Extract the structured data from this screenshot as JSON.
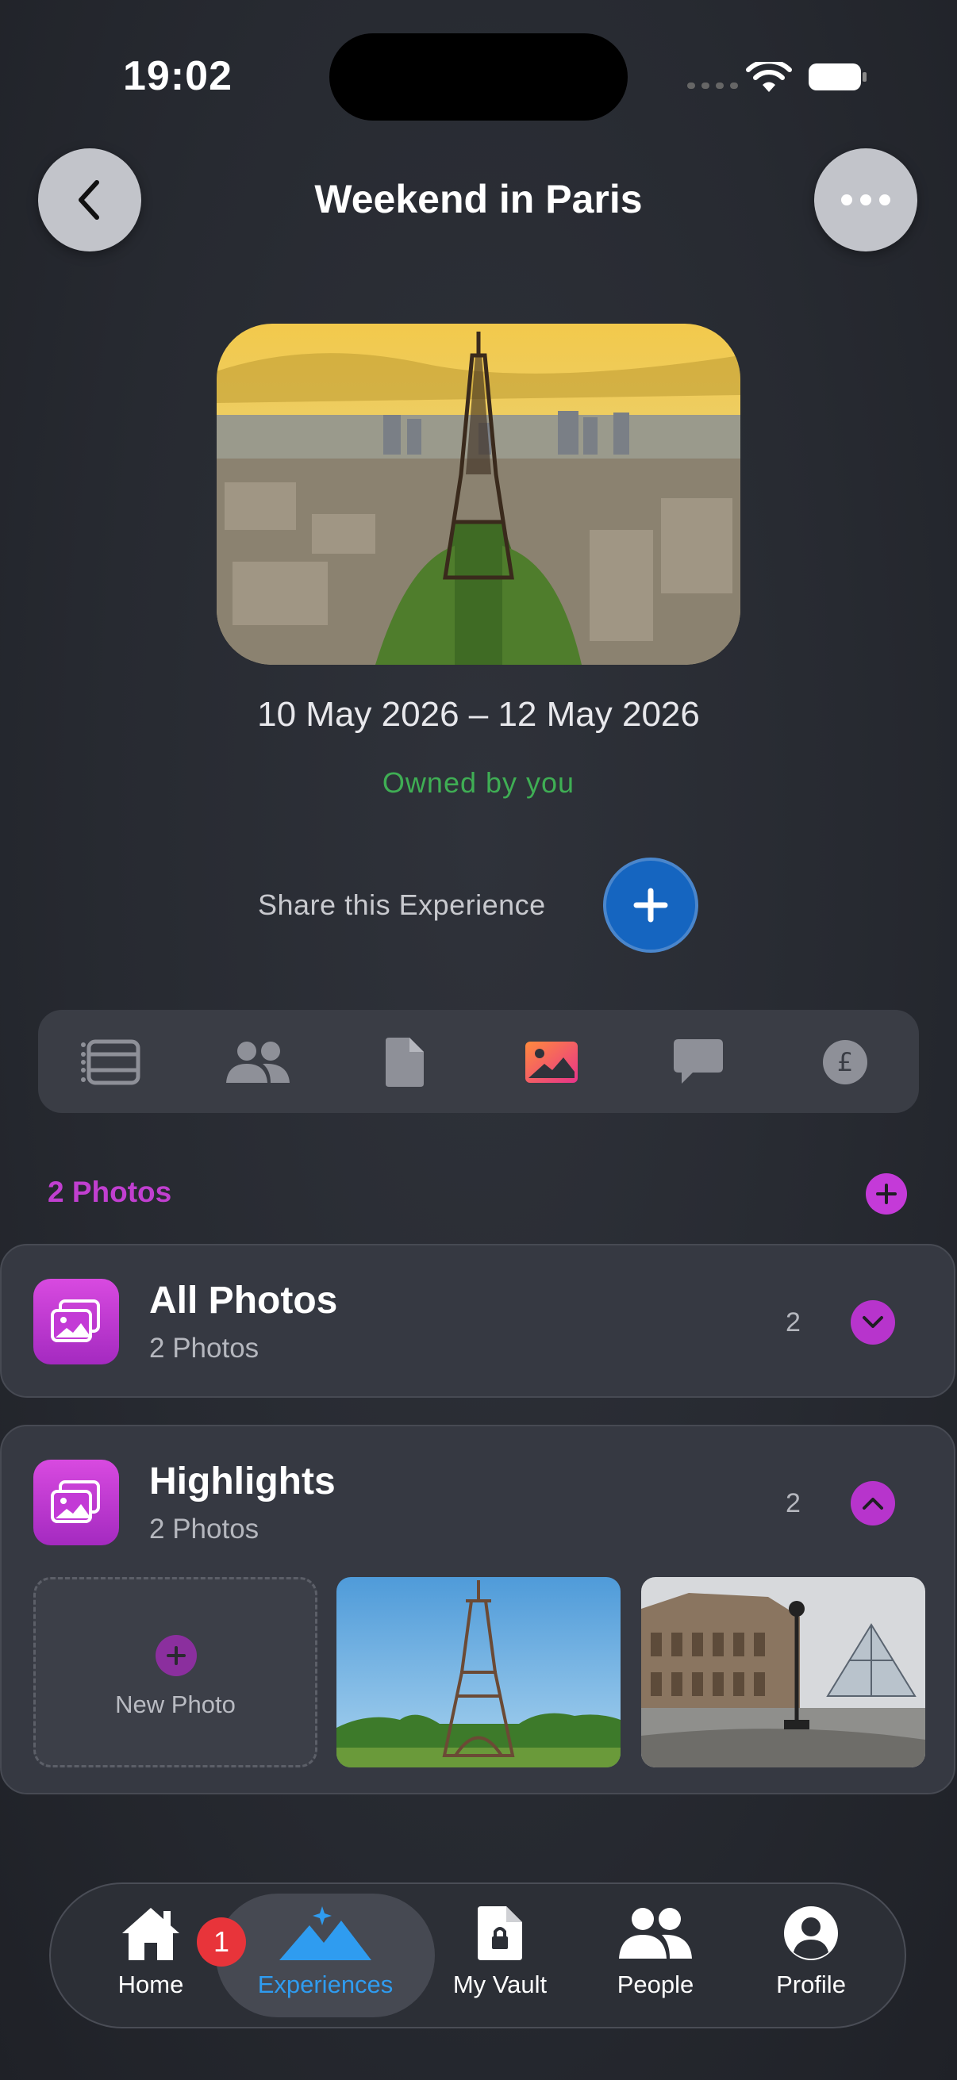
{
  "status_bar": {
    "time": "19:02"
  },
  "header": {
    "title": "Weekend in Paris"
  },
  "experience": {
    "dates": "10 May 2026 – 12 May 2026",
    "owner": "Owned by you",
    "share_label": "Share this Experience"
  },
  "tabs": [
    {
      "icon": "timeline-icon",
      "active": false
    },
    {
      "icon": "people-icon",
      "active": false
    },
    {
      "icon": "document-icon",
      "active": false
    },
    {
      "icon": "photos-icon",
      "active": true
    },
    {
      "icon": "chat-icon",
      "active": false
    },
    {
      "icon": "pound-icon",
      "active": false
    }
  ],
  "photos_section": {
    "count_label": "2 Photos",
    "albums": [
      {
        "title": "All Photos",
        "subtitle": "2 Photos",
        "count": "2",
        "expanded": false
      },
      {
        "title": "Highlights",
        "subtitle": "2 Photos",
        "count": "2",
        "expanded": true
      }
    ],
    "new_photo_label": "New Photo"
  },
  "bottom_nav": {
    "items": [
      {
        "label": "Home",
        "icon": "home-icon",
        "badge": "1"
      },
      {
        "label": "Experiences",
        "icon": "mountains-icon",
        "active": true
      },
      {
        "label": "My Vault",
        "icon": "vault-icon"
      },
      {
        "label": "People",
        "icon": "people-icon"
      },
      {
        "label": "Profile",
        "icon": "profile-icon"
      }
    ]
  },
  "colors": {
    "accent_purple": "#c43ad8",
    "owned_green": "#3fae54",
    "share_blue": "#1565c0",
    "nav_active_blue": "#2f9cf0",
    "badge_red": "#e8343a"
  }
}
